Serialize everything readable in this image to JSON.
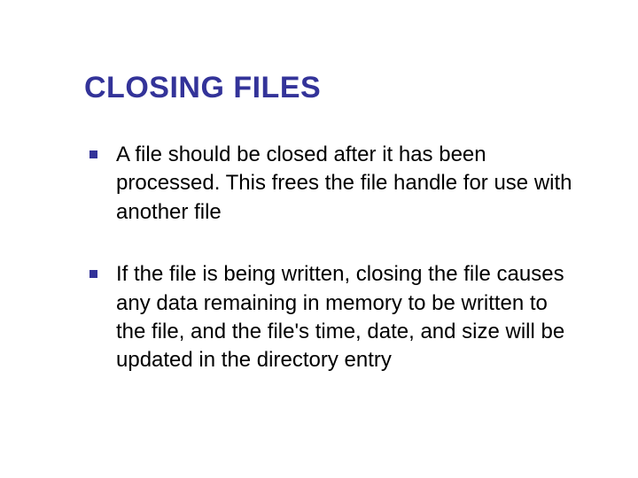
{
  "slide": {
    "title": "CLOSING FILES",
    "bullets": [
      "A file should be closed after it has been processed. This frees the file handle for use with another file",
      "If the file is being written, closing the file causes any data remaining in memory to be written to the file, and the file's time, date, and size will be updated in the directory entry"
    ]
  }
}
